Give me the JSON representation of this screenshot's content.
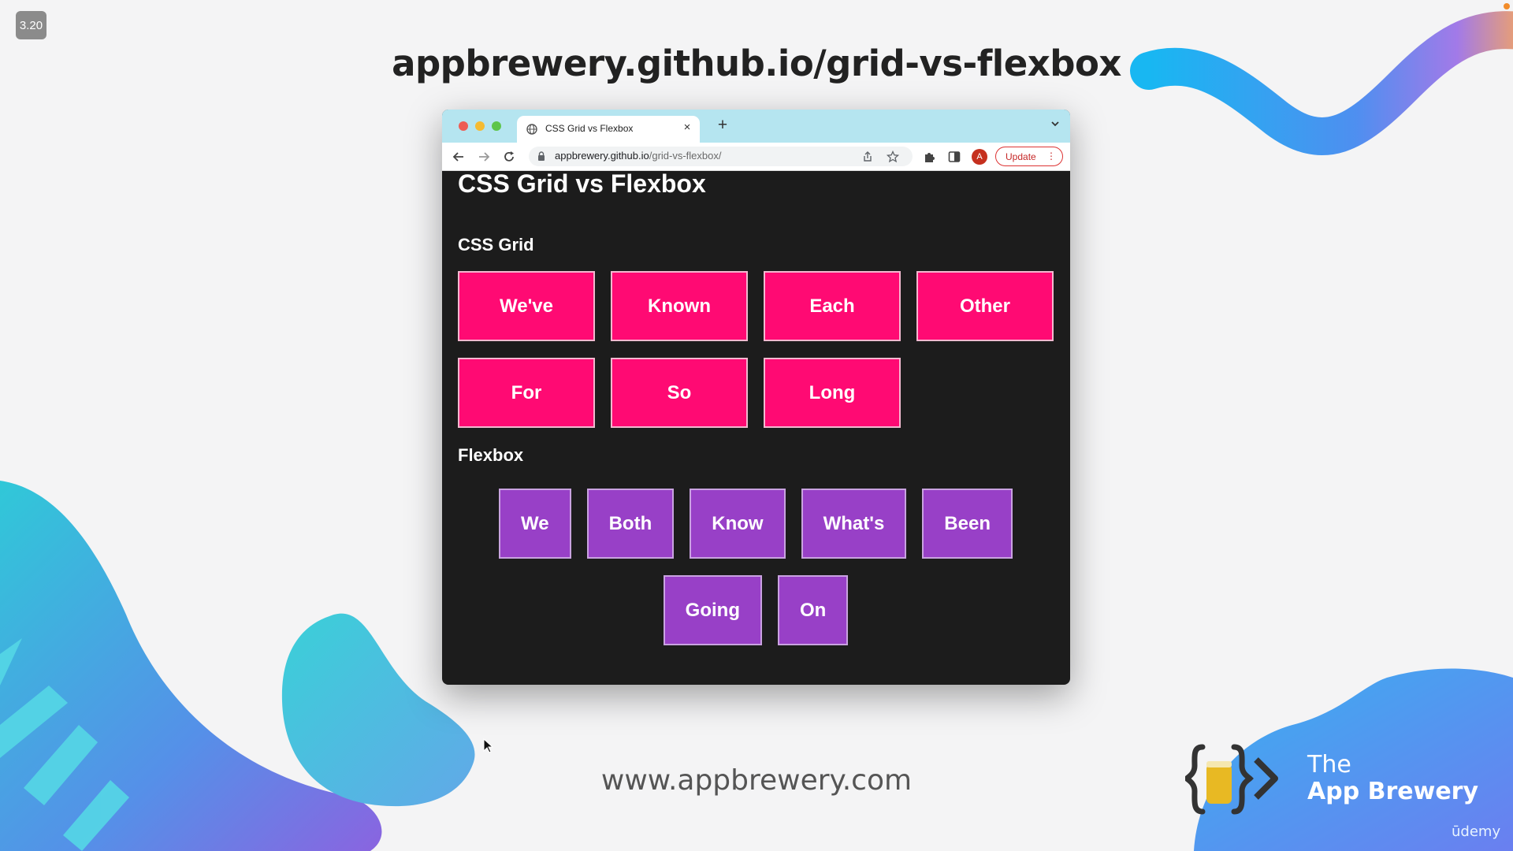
{
  "slide": {
    "version_badge": "3.20",
    "headline": "appbrewery.github.io/grid-vs-flexbox",
    "footer_url": "www.appbrewery.com",
    "brand": {
      "line1": "The",
      "line2": "App Brewery"
    },
    "platform": "ūdemy"
  },
  "browser": {
    "tab": {
      "title": "CSS Grid vs Flexbox",
      "close": "×"
    },
    "new_tab": "+",
    "address": {
      "host": "appbrewery.github.io",
      "path": "/grid-vs-flexbox/"
    },
    "profile_initial": "A",
    "update_label": "Update",
    "menu_glyph": "⋮"
  },
  "page": {
    "title": "CSS Grid vs Flexbox",
    "grid_heading": "CSS Grid",
    "grid_items": [
      "We've",
      "Known",
      "Each",
      "Other",
      "For",
      "So",
      "Long"
    ],
    "flex_heading": "Flexbox",
    "flex_items": [
      "We",
      "Both",
      "Know",
      "What's",
      "Been",
      "Going",
      "On"
    ]
  },
  "colors": {
    "grid_item": "#ff0a73",
    "flex_item": "#9840c7",
    "page_bg": "#1c1c1c",
    "tab_strip": "#b5e5f0"
  },
  "icons": [
    "globe-icon",
    "back-arrow-icon",
    "forward-arrow-icon",
    "reload-icon",
    "lock-icon",
    "share-icon",
    "star-icon",
    "extensions-icon",
    "side-panel-icon",
    "tab-list-chevron-icon",
    "app-brewery-logo"
  ]
}
